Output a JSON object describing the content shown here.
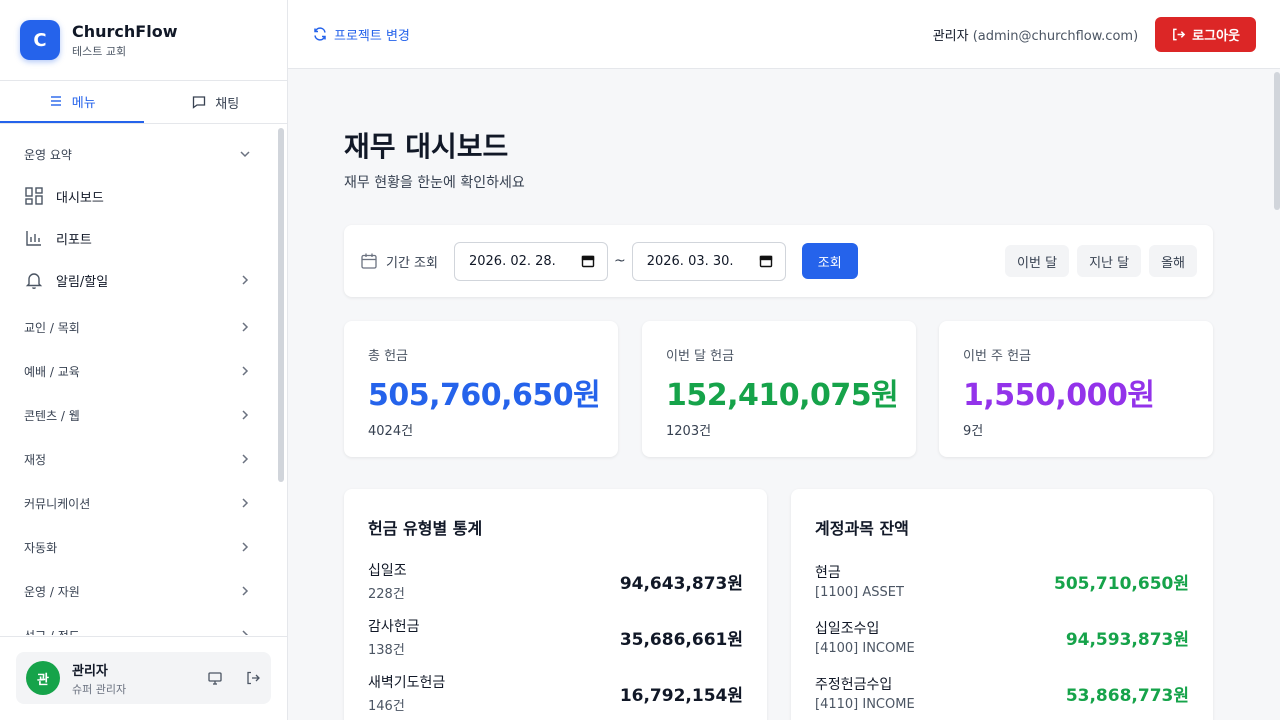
{
  "brand": {
    "logo_letter": "C",
    "name": "ChurchFlow",
    "sub": "테스트 교회"
  },
  "sidebar_tabs": [
    {
      "label": "메뉴",
      "active": true
    },
    {
      "label": "채팅",
      "active": false
    }
  ],
  "nav": {
    "sections": [
      "운영 요약",
      "교인 / 목회",
      "예배 / 교육",
      "콘텐츠 / 웹",
      "재정",
      "커뮤니케이션",
      "자동화",
      "운영 / 자원",
      "선교 / 전도"
    ],
    "items": [
      "대시보드",
      "리포트",
      "알림/할일"
    ]
  },
  "user": {
    "avatar_letter": "관",
    "name": "관리자",
    "role": "슈퍼 관리자"
  },
  "topbar": {
    "project_switch": "프로젝트 변경",
    "admin_name": "관리자",
    "admin_email": "(admin@churchflow.com)",
    "logout": "로그아웃"
  },
  "page": {
    "title": "재무 대시보드",
    "subtitle": "재무 현황을 한눈에 확인하세요"
  },
  "filter": {
    "label": "기간 조회",
    "start_date": "2026. 02. 28.",
    "end_date": "2026. 03. 30.",
    "separator": "~",
    "search": "조회",
    "quick": [
      "이번 달",
      "지난 달",
      "올해"
    ]
  },
  "stats": [
    {
      "label": "총 헌금",
      "value": "505,760,650원",
      "count": "4024건",
      "color": "#2563eb"
    },
    {
      "label": "이번 달 헌금",
      "value": "152,410,075원",
      "count": "1203건",
      "color": "#16a34a"
    },
    {
      "label": "이번 주 헌금",
      "value": "1,550,000원",
      "count": "9건",
      "color": "#9333ea"
    }
  ],
  "offering_stats": {
    "title": "헌금 유형별 통계",
    "rows": [
      {
        "name": "십일조",
        "count": "228건",
        "amount": "94,643,873원"
      },
      {
        "name": "감사헌금",
        "count": "138건",
        "amount": "35,686,661원"
      },
      {
        "name": "새벽기도헌금",
        "count": "146건",
        "amount": "16,792,154원"
      }
    ]
  },
  "account_balance": {
    "title": "계정과목 잔액",
    "rows": [
      {
        "name": "현금",
        "code": "[1100] ASSET",
        "amount": "505,710,650원"
      },
      {
        "name": "십일조수입",
        "code": "[4100] INCOME",
        "amount": "94,593,873원"
      },
      {
        "name": "주정헌금수입",
        "code": "[4110] INCOME",
        "amount": "53,868,773원"
      }
    ]
  }
}
